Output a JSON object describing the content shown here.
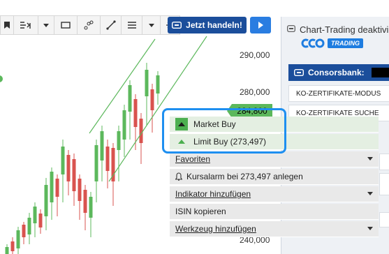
{
  "toolbar": {
    "tools": [
      "bookmark-icon",
      "indicators-icon",
      "rectangle-icon",
      "node-path-icon",
      "line-draw-icon",
      "menu-icon",
      "dropdown-icon",
      "magic-icon"
    ],
    "trade_button_label": "Jetzt handeln!"
  },
  "chart": {
    "price_axis": [
      "290,000",
      "280,000",
      "240,000"
    ],
    "current_price": "284,800",
    "up_color": "#5cb85c",
    "down_color": "#d9534f",
    "channel_color": "#5cb85c"
  },
  "panel": {
    "title": "Chart-Trading deaktivie",
    "trading_badge": "TRADING",
    "broker": "Consorsbank:",
    "rows": [
      "KO-ZERTIFIKATE-MODUS",
      "KO-ZERTIFIKATE SUCHE"
    ]
  },
  "context_menu": {
    "market_buy": "Market Buy",
    "limit_buy": "Limit Buy (273,497)",
    "favoriten": "Favoriten",
    "kursalarm": "Kursalarm bei 273,497 anlegen",
    "indikator": "Indikator hinzufügen",
    "isin": "ISIN kopieren",
    "werkzeug": "Werkzeug hinzufügen",
    "highlight_color": "#1e8ff0"
  }
}
